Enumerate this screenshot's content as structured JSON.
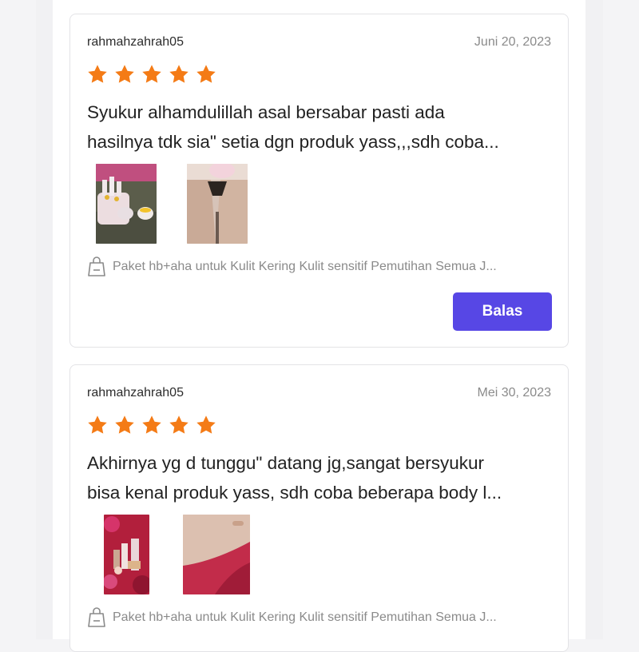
{
  "reviews": [
    {
      "username": "rahmahzahrah05",
      "date": "Juni 20, 2023",
      "rating": 5,
      "text_line1": "Syukur alhamdulillah asal bersabar pasti ada",
      "text_line2": "hasilnya tdk sia\" setia dgn produk yass,,,sdh coba...",
      "variant": "Paket hb+aha untuk Kulit Kering Kulit sensitif Pemutihan  Semua J...",
      "reply_label": "Balas"
    },
    {
      "username": "rahmahzahrah05",
      "date": "Mei 30, 2023",
      "rating": 5,
      "text_line1": "Akhirnya yg d tunggu\" datang jg,sangat bersyukur",
      "text_line2": "bisa kenal produk yass, sdh coba beberapa body l...",
      "variant": "Paket hb+aha untuk Kulit Kering Kulit sensitif Pemutihan  Semua J..."
    }
  ],
  "colors": {
    "star": "#f47b16",
    "button": "#5747e5",
    "muted_text": "#8b8b8b"
  },
  "icons": {
    "star": "star-icon",
    "variant": "shopping-bag-icon"
  }
}
